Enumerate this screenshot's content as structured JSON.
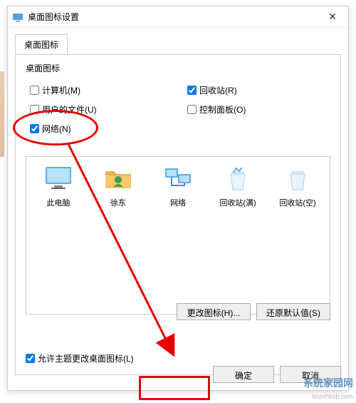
{
  "window": {
    "title": "桌面图标设置",
    "close": "✕"
  },
  "tab": {
    "label": "桌面图标"
  },
  "group": {
    "label": "桌面图标"
  },
  "checkboxes": {
    "computer": {
      "label": "计算机(M)",
      "checked": false
    },
    "recyclebin": {
      "label": "回收站(R)",
      "checked": true
    },
    "userfiles": {
      "label": "用户的文件(U)",
      "checked": false
    },
    "controlpanel": {
      "label": "控制面板(O)",
      "checked": false
    },
    "network": {
      "label": "网络(N)",
      "checked": true
    }
  },
  "icons": {
    "thispc": "此电脑",
    "userfolder": "徐东",
    "network": "网络",
    "recyclefull": "回收站(满)",
    "recycleempty": "回收站(空)"
  },
  "buttons": {
    "changeicon": "更改图标(H)...",
    "restoredefault": "还原默认值(S)",
    "ok": "确定",
    "cancel": "取消"
  },
  "themecheck": {
    "label": "允许主题更改桌面图标(L)",
    "checked": true
  },
  "watermark": {
    "line1": "系统家园网",
    "line2": "hnzxhbsb.com"
  }
}
